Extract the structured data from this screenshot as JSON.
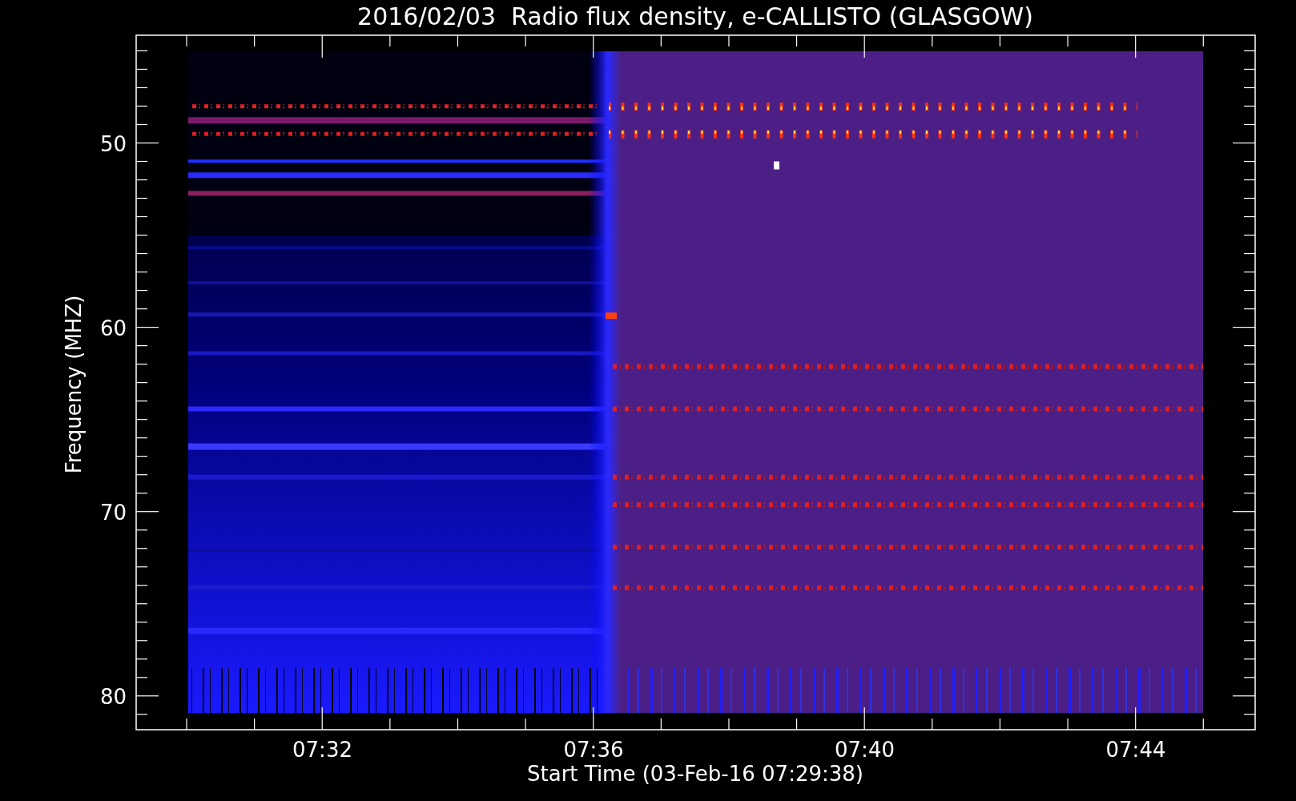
{
  "title": "2016/02/03  Radio flux density, e-CALLISTO (GLASGOW)",
  "y_axis": {
    "label": "Frequency (MHZ)",
    "ticks": [
      "50",
      "60",
      "70",
      "80"
    ]
  },
  "x_axis": {
    "label": "Start Time (03-Feb-16 07:29:38)",
    "ticks": [
      "07:32",
      "07:36",
      "07:40",
      "07:44"
    ]
  }
}
